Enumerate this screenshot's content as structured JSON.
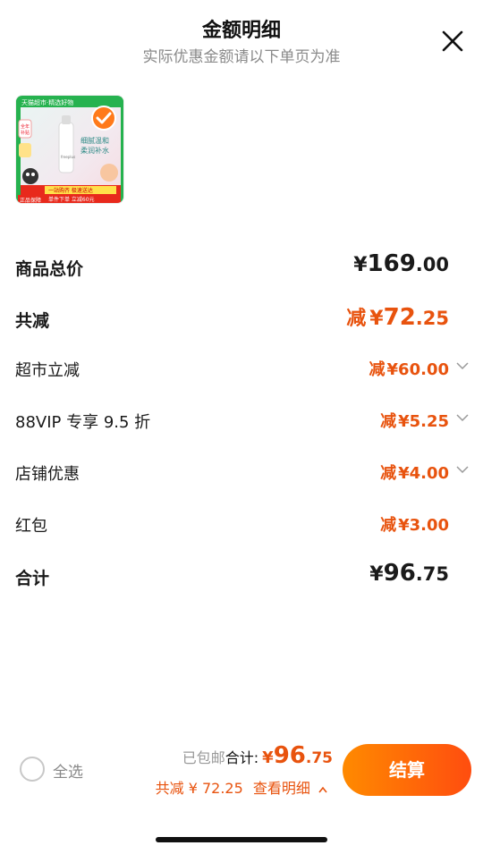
{
  "header": {
    "title": "金额明细",
    "subtitle": "实际优惠金额请以下单页为准"
  },
  "product": {
    "banner_top": "天猫超市·精选好物",
    "tag_left": "全年 补贴",
    "product_text": "细腻温和 柔润补水",
    "badge_bottom_left": "正品保障",
    "strip_1": "一站购齐 极速送达",
    "strip_2": "单件下单 立减60元",
    "bottle_label": "freeplus"
  },
  "breakdown": {
    "total_goods": {
      "label": "商品总价",
      "currency": "¥",
      "int": "169",
      "dec": ".00"
    },
    "total_discount": {
      "label": "共减",
      "prefix": "减",
      "currency": "¥",
      "int": "72",
      "dec": ".25"
    },
    "items": [
      {
        "label": "超市立减",
        "prefix": "减",
        "amount": "¥60.00",
        "has_chevron": true
      },
      {
        "label": "88VIP 专享 9.5 折",
        "prefix": "减",
        "amount": "¥5.25",
        "has_chevron": true
      },
      {
        "label": "店铺优惠",
        "prefix": "减",
        "amount": "¥4.00",
        "has_chevron": true
      },
      {
        "label": "红包",
        "prefix": "减",
        "amount": "¥3.00",
        "has_chevron": false
      }
    ],
    "subtotal": {
      "label": "合计",
      "currency": "¥",
      "int": "96",
      "dec": ".75"
    }
  },
  "footer": {
    "select_all": "全选",
    "shipping": "已包邮",
    "total_label": "合计:",
    "currency": "¥",
    "total_int": "96",
    "total_dec": ".75",
    "discount_text": "共减 ¥ 72.25",
    "details_link": "查看明细",
    "checkout": "结算"
  },
  "colors": {
    "accent": "#e8530e",
    "checkout_start": "#ff8a00",
    "checkout_end": "#ff4d0f",
    "muted": "#8a8a8a"
  }
}
